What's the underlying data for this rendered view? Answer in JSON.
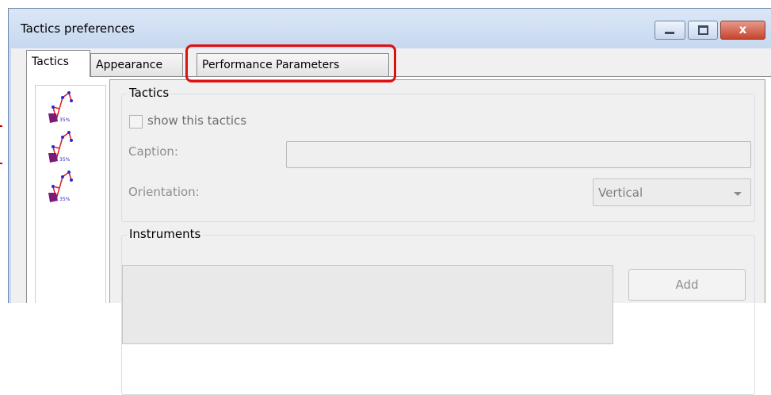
{
  "window": {
    "title": "Tactics preferences",
    "controls": {
      "minimize_icon": "minimize-icon",
      "maximize_icon": "maximize-icon",
      "close_icon": "close-icon",
      "close_glyph": "x"
    },
    "accent": "#c9daf0",
    "close_color": "#c6442e"
  },
  "tabs": [
    {
      "label": "Tactics",
      "active": true
    },
    {
      "label": "Appearance",
      "active": false
    },
    {
      "label": "Performance Parameters",
      "active": false,
      "highlighted": true
    }
  ],
  "highlight_color": "#e01010",
  "tactics_list": {
    "items": [
      {
        "icon": "tactic-formation-icon",
        "caption": "35%"
      },
      {
        "icon": "tactic-formation-icon",
        "caption": "35%"
      },
      {
        "icon": "tactic-formation-icon",
        "caption": "35%"
      }
    ]
  },
  "tactics_group": {
    "legend": "Tactics",
    "show_checkbox": {
      "label": "show this tactics",
      "checked": false
    },
    "caption": {
      "label": "Caption:",
      "value": ""
    },
    "orientation": {
      "label": "Orientation:",
      "value": "Vertical"
    }
  },
  "instruments_group": {
    "legend": "Instruments",
    "add_label": "Add"
  }
}
